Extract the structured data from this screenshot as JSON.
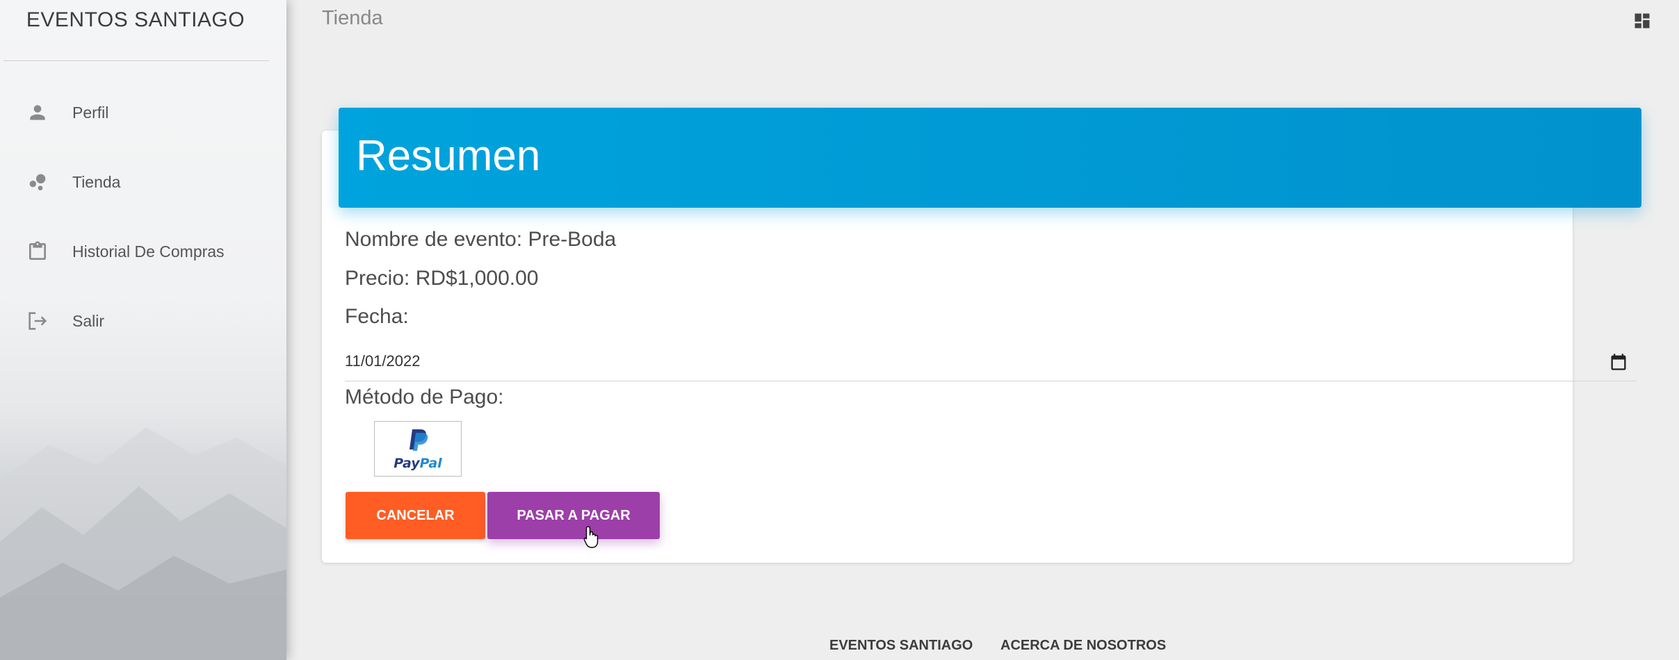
{
  "sidebar": {
    "brand": "EVENTOS SANTIAGO",
    "items": [
      {
        "label": "Perfil",
        "icon": "person-icon"
      },
      {
        "label": "Tienda",
        "icon": "bubble-chart-icon"
      },
      {
        "label": "Historial De Compras",
        "icon": "clipboard-icon"
      },
      {
        "label": "Salir",
        "icon": "exit-icon"
      }
    ]
  },
  "topbar": {
    "title": "Tienda",
    "right_icon": "dashboard-icon"
  },
  "summary": {
    "header": "Resumen",
    "event_name": "Nombre de evento: Pre-Boda",
    "price": "Precio: RD$1,000.00",
    "date_label": "Fecha:",
    "date_value": "11/01/2022",
    "payment_label": "Método de Pago:",
    "paypal": {
      "pay": "Pay",
      "pal": "Pal"
    },
    "cancel_button": "CANCELAR",
    "pay_button": "PASAR A PAGAR"
  },
  "footer": {
    "links": [
      "EVENTOS SANTIAGO",
      "ACERCA DE NOSOTROS"
    ]
  },
  "colors": {
    "header_blue": "#00a3dd",
    "cancel_orange": "#ff5d23",
    "pay_purple": "#9c3fa8",
    "paypal_dark": "#263b80",
    "paypal_light": "#1f8ad2"
  }
}
